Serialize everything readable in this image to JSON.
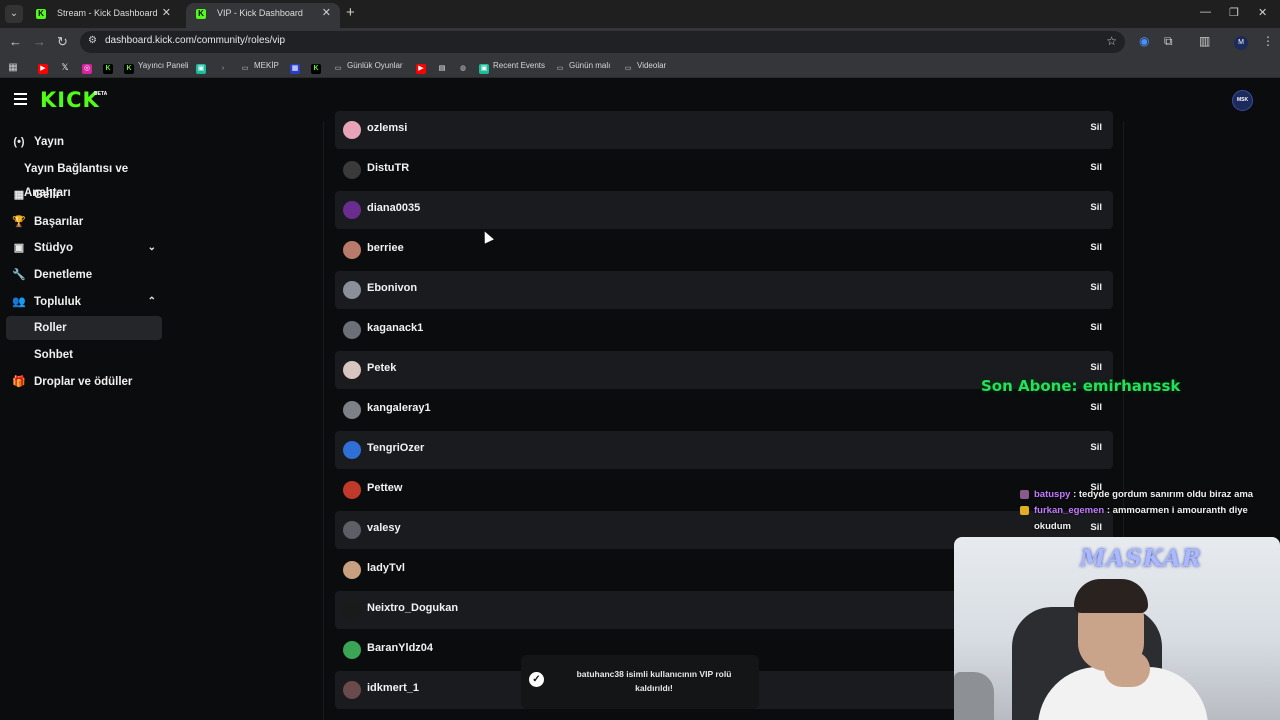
{
  "browser": {
    "tabs": [
      {
        "label": "Stream - Kick Dashboard",
        "active": false
      },
      {
        "label": "VIP - Kick Dashboard",
        "active": true
      }
    ],
    "url": "dashboard.kick.com/community/roles/vip",
    "bookmarks": [
      {
        "label": ""
      },
      {
        "label": ""
      },
      {
        "label": ""
      },
      {
        "label": ""
      },
      {
        "label": "Yayıncı Paneli"
      },
      {
        "label": ""
      },
      {
        "label": ""
      },
      {
        "label": "MEKİP"
      },
      {
        "label": ""
      },
      {
        "label": ""
      },
      {
        "label": "Günlük Oyunlar"
      },
      {
        "label": ""
      },
      {
        "label": ""
      },
      {
        "label": ""
      },
      {
        "label": "Recent Events"
      },
      {
        "label": "Günün malı"
      },
      {
        "label": "Videolar"
      }
    ]
  },
  "header": {
    "logo": "KICK",
    "beta": "BETA",
    "avatar_text": "MSK"
  },
  "sidebar": {
    "items": [
      {
        "label": "Yayın",
        "icon": "broadcast-icon"
      },
      {
        "label": "Yayın Bağlantısı ve Anahtarı",
        "icon": ""
      },
      {
        "label": "Gelir",
        "icon": "chart-icon"
      },
      {
        "label": "Başarılar",
        "icon": "trophy-icon"
      },
      {
        "label": "Stüdyo",
        "icon": "studio-icon"
      },
      {
        "label": "Denetleme",
        "icon": "wrench-icon"
      },
      {
        "label": "Topluluk",
        "icon": "community-icon"
      },
      {
        "label": "Roller",
        "icon": ""
      },
      {
        "label": "Sohbet",
        "icon": ""
      },
      {
        "label": "Droplar ve ödüller",
        "icon": "gift-icon"
      }
    ]
  },
  "vip_list": {
    "delete_label": "Sil",
    "users": [
      {
        "name": "ozlemsi",
        "color": "#e8a3b8"
      },
      {
        "name": "DistuTR",
        "color": "#3a3a3a"
      },
      {
        "name": "diana0035",
        "color": "#6b2c8f"
      },
      {
        "name": "berriee",
        "color": "#b87a6a"
      },
      {
        "name": "Ebonivon",
        "color": "#8a8f99"
      },
      {
        "name": "kaganack1",
        "color": "#6c6f78"
      },
      {
        "name": "Petek",
        "color": "#d9c5c0"
      },
      {
        "name": "kangaleray1",
        "color": "#7d8087"
      },
      {
        "name": "TengriOzer",
        "color": "#2f6fd6"
      },
      {
        "name": "Pettew",
        "color": "#c0392b"
      },
      {
        "name": "valesy",
        "color": "#5c5f66"
      },
      {
        "name": "ladyTvl",
        "color": "#c8a080"
      },
      {
        "name": "Neixtro_Dogukan",
        "color": "#1a1a1a"
      },
      {
        "name": "BaranYldz04",
        "color": "#3aa655"
      },
      {
        "name": "idkmert_1",
        "color": "#6a4a4a"
      }
    ]
  },
  "toast": {
    "message": "batuhanc38 isimli kullanıcının VIP rolü kaldırıldı!"
  },
  "stream_overlay": {
    "last_sub": "Son Abone: emirhanssk",
    "brand": "MASKAR",
    "chat": [
      {
        "user": "batuspy",
        "message": " : tedyde gordum sanırım oldu biraz ama",
        "user_color": "#c27cff",
        "badge_color": "#8a5a8a"
      },
      {
        "user": "furkan_egemen",
        "message": " : ammoarmen i amouranth diye okudum",
        "user_color": "#c27cff",
        "badge_color": "#e0b020"
      }
    ]
  }
}
